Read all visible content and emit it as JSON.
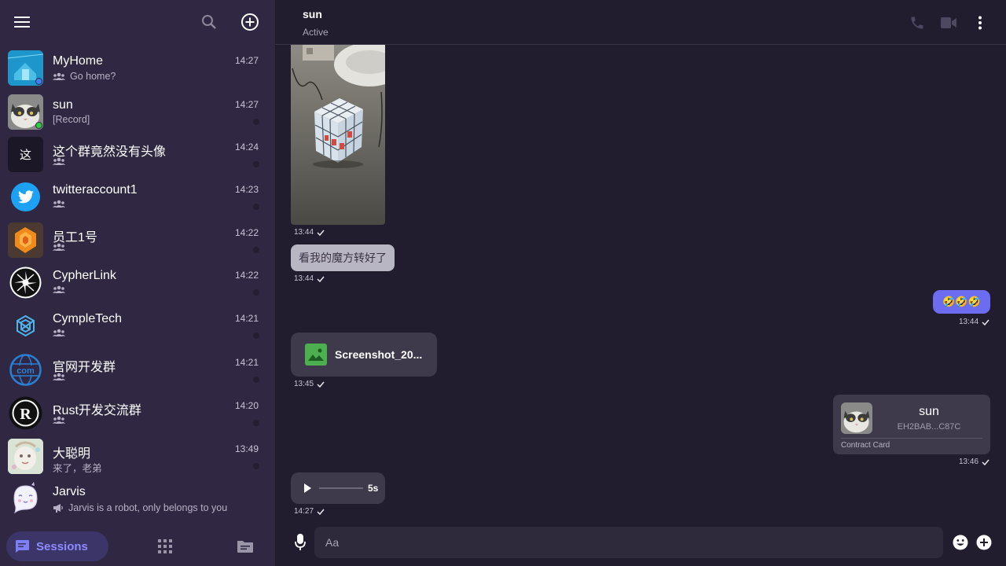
{
  "sidebar": {
    "menu_icon": "menu-icon",
    "search_icon": "search-icon",
    "add_icon": "add-circle-icon",
    "sessions": [
      {
        "title": "MyHome",
        "time": "14:27",
        "subtitle": "Go home?",
        "kind": "group",
        "status": "blue"
      },
      {
        "title": "sun",
        "time": "14:27",
        "subtitle": "[Record]",
        "kind": "direct",
        "status": "green"
      },
      {
        "title": "这个群竟然没有头像",
        "time": "14:24",
        "subtitle": "",
        "kind": "group",
        "avatar_letter": "这"
      },
      {
        "title": "twitteraccount1",
        "time": "14:23",
        "subtitle": "",
        "kind": "group"
      },
      {
        "title": "员工1号",
        "time": "14:22",
        "subtitle": "",
        "kind": "group"
      },
      {
        "title": "CypherLink",
        "time": "14:22",
        "subtitle": "",
        "kind": "group"
      },
      {
        "title": "CympleTech",
        "time": "14:21",
        "subtitle": "",
        "kind": "group"
      },
      {
        "title": "官网开发群",
        "time": "14:21",
        "subtitle": "",
        "kind": "group",
        "avatar_letter": "com"
      },
      {
        "title": "Rust开发交流群",
        "time": "14:20",
        "subtitle": "",
        "kind": "group",
        "avatar_letter": "R"
      },
      {
        "title": "大聪明",
        "time": "13:49",
        "subtitle": "来了，老弟",
        "kind": "direct"
      },
      {
        "title": "Jarvis",
        "time": "",
        "subtitle": "Jarvis is a robot, only belongs to you",
        "kind": "bot"
      }
    ],
    "bottom": {
      "sessions_label": "Sessions",
      "apps_icon": "apps-grid-icon",
      "files_icon": "folder-icon"
    }
  },
  "chat": {
    "name": "sun",
    "status": "Active",
    "messages": [
      {
        "type": "image",
        "time": "13:44",
        "side": "left"
      },
      {
        "type": "text",
        "text": "看我的魔方转好了",
        "time": "13:44",
        "side": "left"
      },
      {
        "type": "text",
        "text": "🤣🤣🤣",
        "time": "13:44",
        "side": "right"
      },
      {
        "type": "file",
        "name": "Screenshot_20...",
        "time": "13:45",
        "side": "left"
      },
      {
        "type": "contact",
        "name": "sun",
        "id": "EH2BAB...C87C",
        "label": "Contract Card",
        "time": "13:46",
        "side": "right"
      },
      {
        "type": "voice",
        "duration": "5s",
        "time": "14:27",
        "side": "left"
      }
    ],
    "input_placeholder": "Aa"
  },
  "colors": {
    "sidebar_bg": "#302842",
    "chat_bg": "#221d2e",
    "accent": "#6b6cf0",
    "online": "#2ecc40",
    "group_dot": "#3b82f6"
  }
}
